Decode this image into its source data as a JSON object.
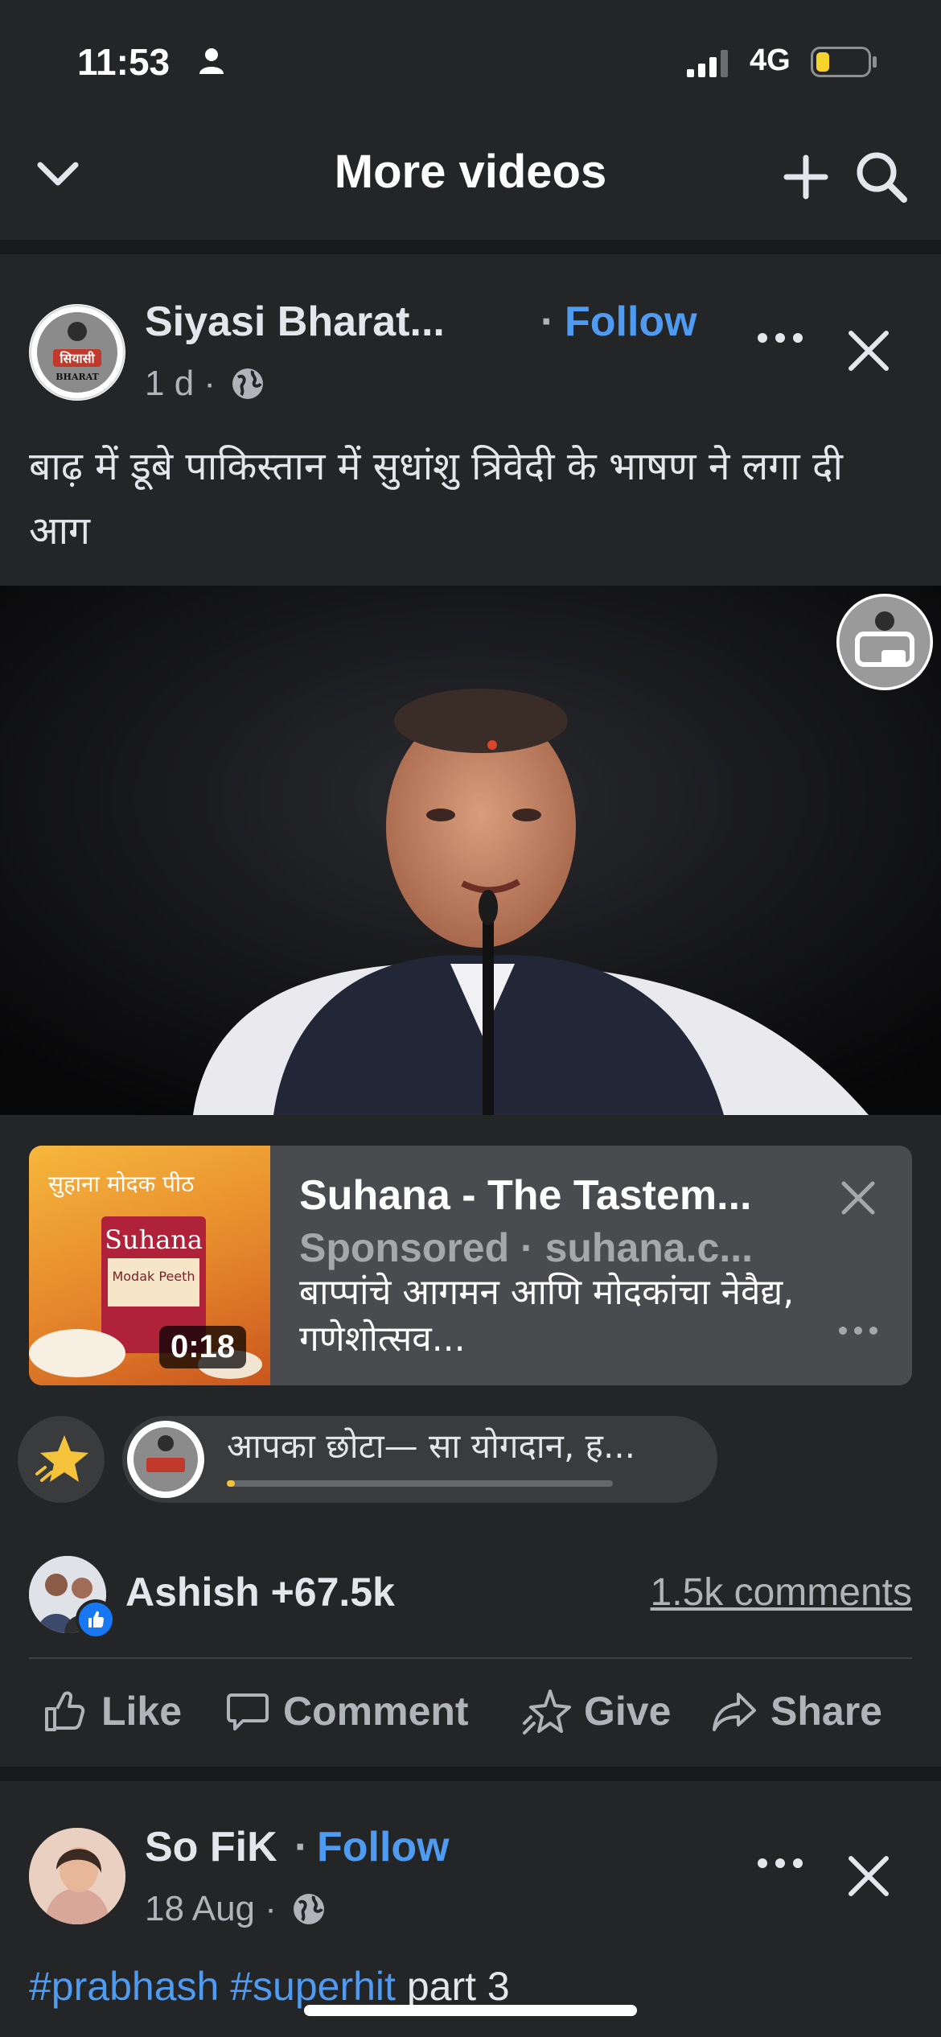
{
  "status_bar": {
    "time": "11:53",
    "network": "4G",
    "battery_level": 0.25
  },
  "header": {
    "title": "More videos"
  },
  "post1": {
    "author": "Siyasi Bharat...",
    "follow_separator": "·",
    "follow_label": "Follow",
    "time": "1 d ·",
    "caption": "बाढ़ में डूबे पाकिस्तान में सुधांशु त्रिवेदी के भाषण ने लगा दी आग",
    "avatar_text": "सियासी",
    "avatar_subtext": "BHARAT"
  },
  "ad": {
    "thumb_text": "सुहाना मोदक पीठ",
    "brand_label": "Suhana",
    "product_label": "Modak Peeth",
    "duration": "0:18",
    "title": "Suhana - The Tastem...",
    "sponsored": "Sponsored · suhana.c...",
    "description": "बाप्पांचे आगमन आणि मोदकांचा नेवैद्य, गणेशोत्सव..."
  },
  "fundraiser": {
    "text": "आपका छोटा— सा योगदान, ह...",
    "progress": 0.02
  },
  "reactions": {
    "summary": "Ashish +67.5k",
    "comments": "1.5k comments"
  },
  "actions": {
    "like": "Like",
    "comment": "Comment",
    "give": "Give",
    "share": "Share"
  },
  "post2": {
    "author": "So FiK",
    "follow_separator": "·",
    "follow_label": "Follow",
    "time": "18 Aug ·",
    "hashtag1": "#prabhash",
    "hashtag2": "#superhit",
    "caption_rest": "part 3"
  },
  "colors": {
    "accent": "#4e9bf1",
    "background": "#242526",
    "like_blue": "#1877f2"
  }
}
